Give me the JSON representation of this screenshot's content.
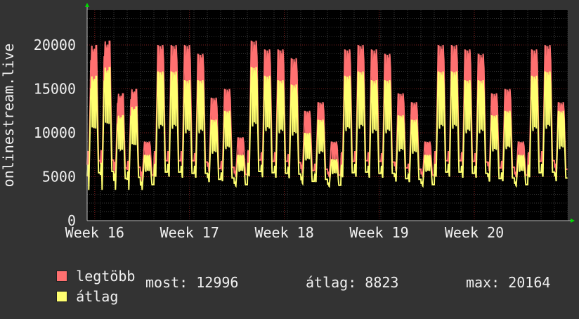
{
  "colors": {
    "background": "#333333",
    "plot_background": "#000000",
    "grid_major": "#7a1f1f",
    "grid_minor": "#3a3a3a",
    "axis": "#bfbfbf",
    "max_series": "#ff7070",
    "avg_series": "#ffff70",
    "arrow": "#00dd00"
  },
  "chart_data": {
    "type": "line",
    "title": "",
    "xlabel": "",
    "ylabel": "onlinestream.live",
    "ylim": [
      0,
      24000
    ],
    "yticks": [
      0,
      5000,
      10000,
      15000,
      20000
    ],
    "ytick_labels": [
      "0",
      "5000",
      "10000",
      "15000",
      "20000"
    ],
    "xlim_days": [
      0,
      36
    ],
    "xticks": [
      {
        "label": "Week 16",
        "day": 0.57
      },
      {
        "label": "Week 17",
        "day": 7.67
      },
      {
        "label": "Week 18",
        "day": 14.77
      },
      {
        "label": "Week 19",
        "day": 21.87
      },
      {
        "label": "Week 20",
        "day": 29.0
      }
    ],
    "daily_peaks": [
      {
        "day": 0.3,
        "max": 20000,
        "avg": 16500
      },
      {
        "day": 1.3,
        "max": 20500,
        "avg": 17500
      },
      {
        "day": 2.3,
        "max": 14500,
        "avg": 12000
      },
      {
        "day": 3.3,
        "max": 15000,
        "avg": 13000
      },
      {
        "day": 4.3,
        "max": 9000,
        "avg": 7500
      },
      {
        "day": 5.3,
        "max": 20000,
        "avg": 17000
      },
      {
        "day": 6.3,
        "max": 20000,
        "avg": 17000
      },
      {
        "day": 7.3,
        "max": 20000,
        "avg": 16000
      },
      {
        "day": 8.3,
        "max": 19000,
        "avg": 16000
      },
      {
        "day": 9.3,
        "max": 14000,
        "avg": 11500
      },
      {
        "day": 10.3,
        "max": 15000,
        "avg": 12500
      },
      {
        "day": 11.3,
        "max": 9500,
        "avg": 7500
      },
      {
        "day": 12.3,
        "max": 20500,
        "avg": 17500
      },
      {
        "day": 13.3,
        "max": 19500,
        "avg": 16500
      },
      {
        "day": 14.3,
        "max": 19500,
        "avg": 16000
      },
      {
        "day": 15.3,
        "max": 18500,
        "avg": 15500
      },
      {
        "day": 16.3,
        "max": 12500,
        "avg": 10000
      },
      {
        "day": 17.3,
        "max": 13500,
        "avg": 11500
      },
      {
        "day": 18.3,
        "max": 9000,
        "avg": 7000
      },
      {
        "day": 19.3,
        "max": 19500,
        "avg": 16500
      },
      {
        "day": 20.3,
        "max": 20000,
        "avg": 17000
      },
      {
        "day": 21.3,
        "max": 19500,
        "avg": 16000
      },
      {
        "day": 22.3,
        "max": 19000,
        "avg": 16000
      },
      {
        "day": 23.3,
        "max": 14500,
        "avg": 12000
      },
      {
        "day": 24.3,
        "max": 13500,
        "avg": 11500
      },
      {
        "day": 25.3,
        "max": 9000,
        "avg": 7500
      },
      {
        "day": 26.3,
        "max": 20000,
        "avg": 17000
      },
      {
        "day": 27.3,
        "max": 20000,
        "avg": 17000
      },
      {
        "day": 28.3,
        "max": 19500,
        "avg": 16000
      },
      {
        "day": 29.3,
        "max": 19000,
        "avg": 16000
      },
      {
        "day": 30.3,
        "max": 14500,
        "avg": 12000
      },
      {
        "day": 31.3,
        "max": 15000,
        "avg": 12500
      },
      {
        "day": 32.3,
        "max": 9000,
        "avg": 7500
      },
      {
        "day": 33.3,
        "max": 19500,
        "avg": 16500
      },
      {
        "day": 34.3,
        "max": 20000,
        "avg": 17000
      },
      {
        "day": 35.5,
        "max": 13500,
        "avg": 12500
      }
    ],
    "daily_baseline": {
      "max": 4500,
      "avg": 3500
    },
    "series": [
      {
        "name": "legtöbb",
        "color": "#ff7070"
      },
      {
        "name": "átlag",
        "color": "#ffff70"
      }
    ]
  },
  "legend": {
    "max_label": "legtöbb",
    "avg_label": "átlag"
  },
  "stats": {
    "current": "most: 12996",
    "average": "átlag: 8823",
    "maximum": "max: 20164"
  }
}
